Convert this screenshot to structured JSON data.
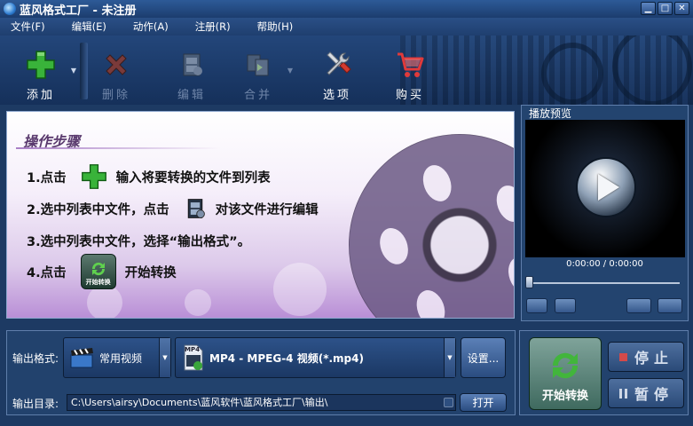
{
  "window": {
    "title": "蓝风格式工厂 - 未注册"
  },
  "menu": {
    "items": [
      "文件(F)",
      "编辑(E)",
      "动作(A)",
      "注册(R)",
      "帮助(H)"
    ]
  },
  "toolbar": {
    "add": "添加",
    "delete": "删除",
    "edit": "编辑",
    "merge": "合并",
    "options": "选项",
    "buy": "购买"
  },
  "steps": {
    "title": "操作步骤",
    "s1_num": "1.点击",
    "s1_text": "输入将要转换的文件到列表",
    "s2_num": "2.选中列表中文件，点击",
    "s2_text": "对该文件进行编辑",
    "s3": "3.选中列表中文件，选择“输出格式”。",
    "s4_num": "4.点击",
    "s4_text": "开始转换",
    "s4_icon_label": "开始转换"
  },
  "preview": {
    "title": "播放预览",
    "timecode": "0:00:00 / 0:00:00"
  },
  "output": {
    "format_label": "输出格式:",
    "category": "常用视频",
    "format": "MP4 - MPEG-4 视频(*.mp4)",
    "format_icon_text": "MP4",
    "settings": "设置...",
    "dir_label": "输出目录:",
    "dir_path": "C:\\Users\\airsy\\Documents\\蓝风软件\\蓝风格式工厂\\输出\\",
    "open": "打开"
  },
  "actions": {
    "start": "开始转换",
    "stop": "停止",
    "pause": "暂停"
  },
  "colors": {
    "accent": "#2a4f86",
    "steps_bg_bottom": "#b98fd6",
    "start_green": "#3fae3a"
  }
}
